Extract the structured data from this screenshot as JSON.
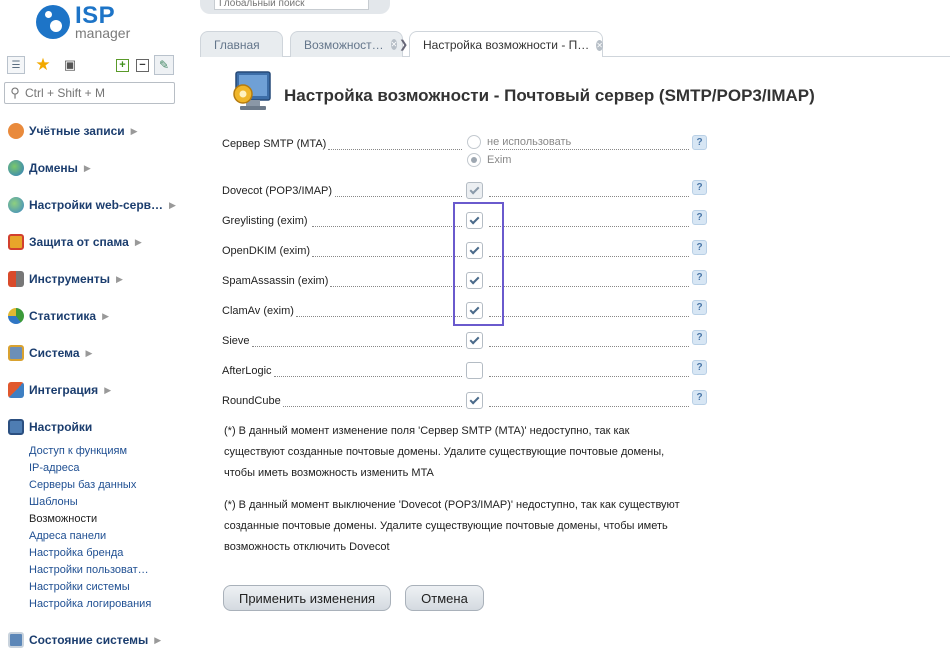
{
  "logo": {
    "brand": "ISP",
    "sub": "manager"
  },
  "sidebar": {
    "search_placeholder": "Ctrl + Shift + M",
    "items": [
      {
        "label": "Учётные записи",
        "icon": "users-icon"
      },
      {
        "label": "Домены",
        "icon": "globe-icon"
      },
      {
        "label": "Настройки web-серв…",
        "icon": "web-settings-icon"
      },
      {
        "label": "Защита от спама",
        "icon": "shield-icon"
      },
      {
        "label": "Инструменты",
        "icon": "tools-icon"
      },
      {
        "label": "Статистика",
        "icon": "pie-chart-icon"
      },
      {
        "label": "Система",
        "icon": "system-icon"
      },
      {
        "label": "Интеграция",
        "icon": "integration-icon"
      },
      {
        "label": "Настройки",
        "icon": "settings-icon"
      },
      {
        "label": "Состояние системы",
        "icon": "monitor-icon"
      }
    ],
    "settings_subitems": [
      "Доступ к функциям",
      "IP-адреса",
      "Серверы баз данных",
      "Шаблоны",
      "Возможности",
      "Адреса панели",
      "Настройка бренда",
      "Настройки пользоват…",
      "Настройки системы",
      "Настройка логирования"
    ],
    "active_subitem": "Возможности"
  },
  "header": {
    "global_search_placeholder": "Глобальный поиск"
  },
  "tabs": [
    {
      "label": "Главная",
      "closable": false
    },
    {
      "label": "Возможност…",
      "closable": true
    },
    {
      "label": "Настройка возможности - П…",
      "closable": true,
      "active": true
    }
  ],
  "form": {
    "title": "Настройка возможности - Почтовый сервер (SMTP/POP3/IMAP)",
    "smtp": {
      "label": "Сервер SMTP (MTA)",
      "options": [
        "не использовать",
        "Exim"
      ],
      "selected": "Exim"
    },
    "checkboxes": [
      {
        "label": "Dovecot (POP3/IMAP)",
        "checked": true,
        "disabled": true
      },
      {
        "label": "Greylisting (exim)",
        "checked": true,
        "disabled": false
      },
      {
        "label": "OpenDKIM (exim)",
        "checked": true,
        "disabled": false
      },
      {
        "label": "SpamAssassin (exim)",
        "checked": true,
        "disabled": false
      },
      {
        "label": "ClamAv (exim)",
        "checked": true,
        "disabled": false
      },
      {
        "label": "Sieve",
        "checked": true,
        "disabled": false
      },
      {
        "label": "AfterLogic",
        "checked": false,
        "disabled": false
      },
      {
        "label": "RoundCube",
        "checked": true,
        "disabled": false
      }
    ],
    "help_symbol": "?",
    "notes": [
      [
        "(*) В данный момент изменение поля 'Сервер SMTP (MTA)' недоступно, так как",
        "существуют созданные почтовые домены. Удалите существующие почтовые домены,",
        "чтобы иметь возможность изменить MTA"
      ],
      [
        "(*) В данный момент выключение 'Dovecot (POP3/IMAP)' недоступно, так как существуют",
        "созданные почтовые домены. Удалите существующие почтовые домены, чтобы иметь",
        "возможность отключить Dovecot"
      ]
    ],
    "apply_label": "Применить изменения",
    "cancel_label": "Отмена"
  },
  "colors": {
    "brand": "#1d74c7",
    "nav_text": "#1b3d6e",
    "highlight": "#6a5acd"
  }
}
